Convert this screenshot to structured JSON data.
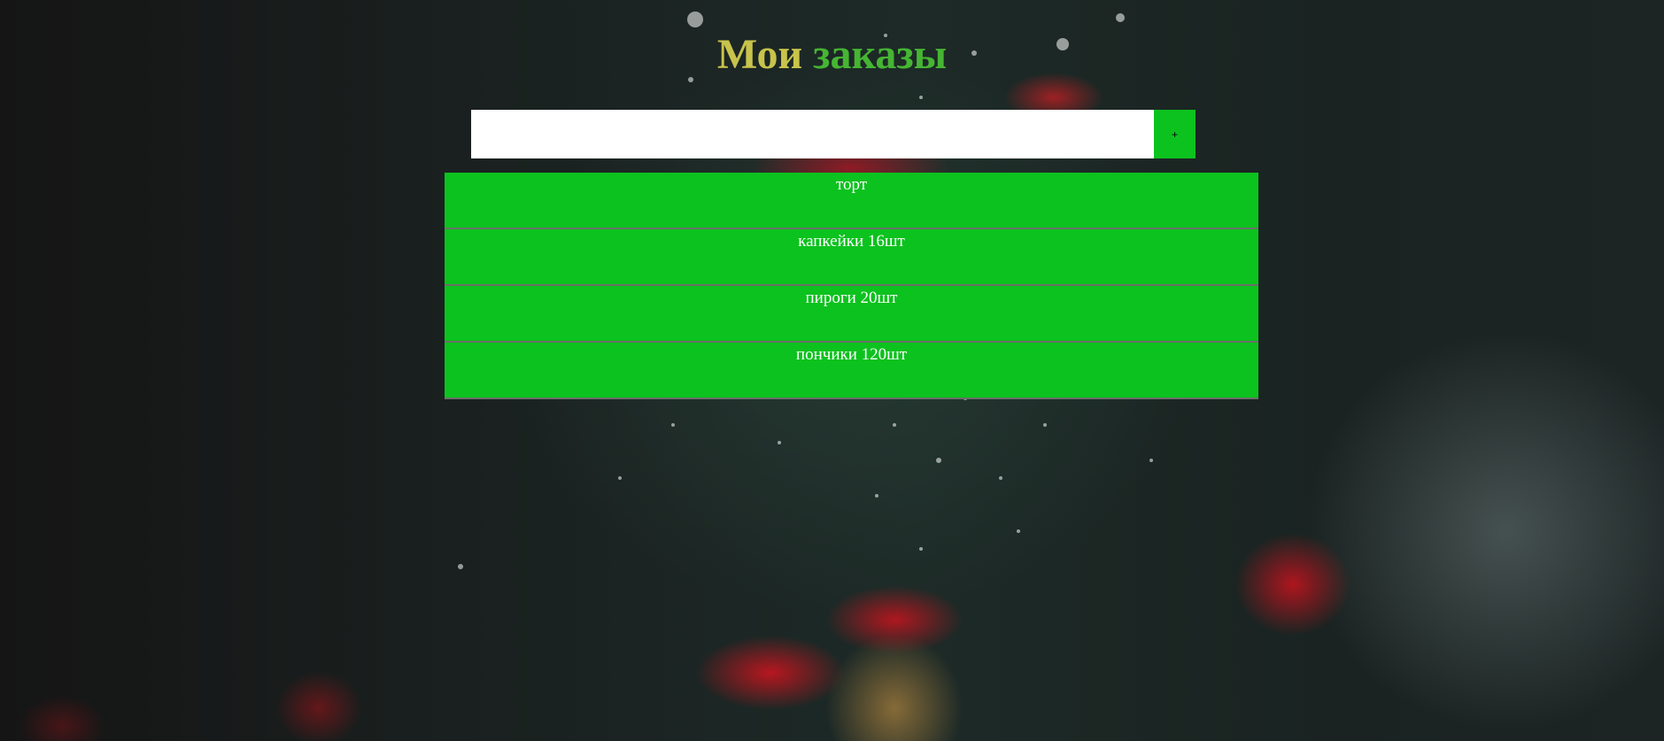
{
  "page": {
    "title_word_1": "Мои",
    "title_word_2": "заказы"
  },
  "form": {
    "input_value": "",
    "input_placeholder": "",
    "add_button_label": "+"
  },
  "orders": [
    {
      "label": "торт"
    },
    {
      "label": "капкейки 16шт"
    },
    {
      "label": "пироги 20шт"
    },
    {
      "label": "пончики 120шт"
    }
  ],
  "colors": {
    "item_background": "#0cc21e",
    "title_word_1": "#c8c34b",
    "title_word_2": "#46b533",
    "input_background": "#ffffff"
  },
  "icons": {
    "background": "strawberry-tart-photo"
  }
}
